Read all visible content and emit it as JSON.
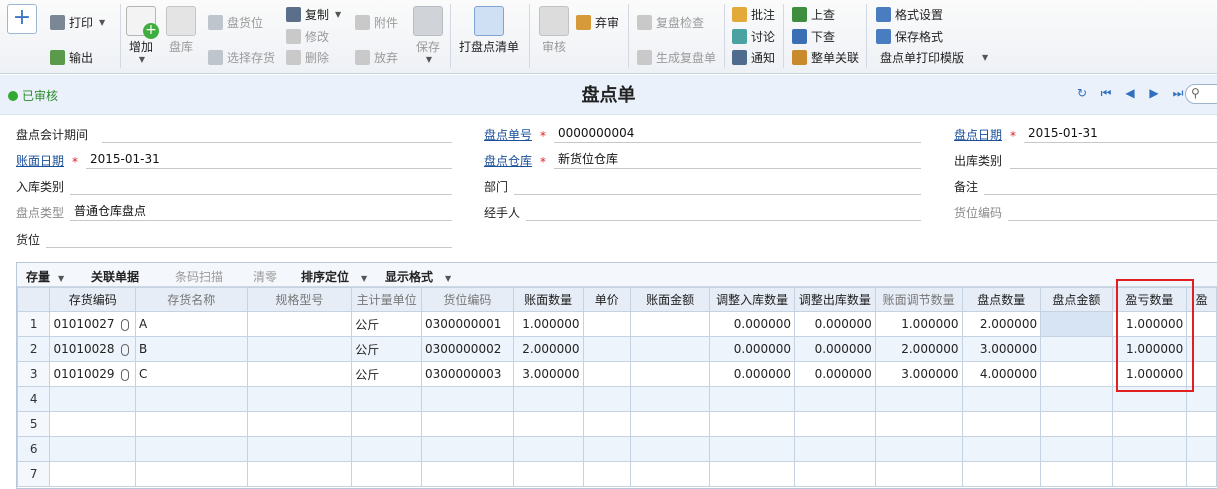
{
  "toolbar": {
    "print": "打印",
    "export": "输出",
    "add": "增加",
    "inventory": "盘库",
    "inventory_location": "盘货位",
    "select_stock": "选择存货",
    "copy": "复制",
    "modify": "修改",
    "delete": "删除",
    "attachment": "附件",
    "discard": "放弃",
    "save": "保存",
    "print_list": "打盘点清单",
    "audit": "审核",
    "abandon_audit": "弃审",
    "recheck": "复盘检查",
    "gen_recheck": "生成复盘单",
    "annotate": "批注",
    "discuss": "讨论",
    "notify": "通知",
    "prev_query": "上查",
    "next_query": "下查",
    "link_doc": "整单关联",
    "format_settings": "格式设置",
    "save_format": "保存格式",
    "print_template": "盘点单打印模版"
  },
  "header": {
    "status": "已审核",
    "title": "盘点单"
  },
  "form": {
    "period_label": "盘点会计期间",
    "period_value": "",
    "doc_no_label": "盘点单号",
    "doc_no_value": "0000000004",
    "check_date_label": "盘点日期",
    "check_date_value": "2015-01-31",
    "book_date_label": "账面日期",
    "book_date_value": "2015-01-31",
    "warehouse_label": "盘点仓库",
    "warehouse_value": "新货位仓库",
    "out_type_label": "出库类别",
    "out_type_value": "",
    "in_type_label": "入库类别",
    "in_type_value": "",
    "dept_label": "部门",
    "dept_value": "",
    "remark_label": "备注",
    "remark_value": "",
    "check_type_label": "盘点类型",
    "check_type_value": "普通仓库盘点",
    "handler_label": "经手人",
    "handler_value": "",
    "loc_code_label": "货位编码",
    "loc_code_value": "",
    "location_label": "货位",
    "location_value": ""
  },
  "grid_toolbar": {
    "stock": "存量",
    "linked_docs": "关联单据",
    "barcode_scan": "条码扫描",
    "clear_zero": "清零",
    "sort_locate": "排序定位",
    "display_format": "显示格式"
  },
  "columns": [
    "",
    "存货编码",
    "存货名称",
    "规格型号",
    "主计量单位",
    "货位编码",
    "账面数量",
    "单价",
    "账面金额",
    "调整入库数量",
    "调整出库数量",
    "账面调节数量",
    "盘点数量",
    "盘点金额",
    "盈亏数量",
    "盈"
  ],
  "rows": [
    {
      "no": "1",
      "code": "01010027",
      "name": "A",
      "spec": "",
      "unit": "公斤",
      "loc": "0300000001",
      "book_qty": "1.000000",
      "price": "",
      "book_amt": "",
      "adj_in": "0.000000",
      "adj_out": "0.000000",
      "adj_book": "1.000000",
      "check_qty": "2.000000",
      "check_amt": "",
      "pl_qty": "1.000000"
    },
    {
      "no": "2",
      "code": "01010028",
      "name": "B",
      "spec": "",
      "unit": "公斤",
      "loc": "0300000002",
      "book_qty": "2.000000",
      "price": "",
      "book_amt": "",
      "adj_in": "0.000000",
      "adj_out": "0.000000",
      "adj_book": "2.000000",
      "check_qty": "3.000000",
      "check_amt": "",
      "pl_qty": "1.000000"
    },
    {
      "no": "3",
      "code": "01010029",
      "name": "C",
      "spec": "",
      "unit": "公斤",
      "loc": "0300000003",
      "book_qty": "3.000000",
      "price": "",
      "book_amt": "",
      "adj_in": "0.000000",
      "adj_out": "0.000000",
      "adj_book": "3.000000",
      "check_qty": "4.000000",
      "check_amt": "",
      "pl_qty": "1.000000"
    }
  ],
  "empty_rows": [
    "4",
    "5",
    "6",
    "7"
  ],
  "colors": {
    "accent": "#1a4f99",
    "status_green": "#33a833",
    "highlight": "#e02020"
  }
}
